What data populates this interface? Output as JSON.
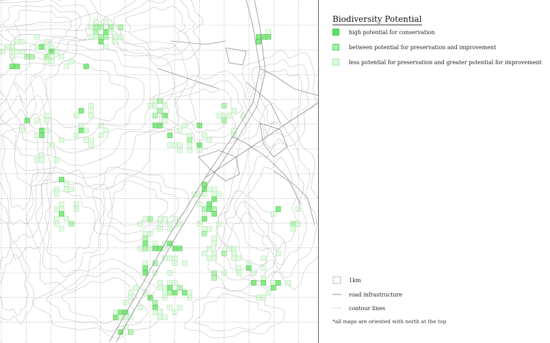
{
  "legend": {
    "title": "Biodiversity Potential",
    "categories": [
      {
        "label": "high potential for conservation",
        "fill": "#5ee35e",
        "stroke": "#3fbf3f"
      },
      {
        "label": "between potential for preservation and improvement",
        "fill": "#a3f0a3",
        "stroke": "#5fd15f"
      },
      {
        "label": "less potential for preservation and greater potential for improvement",
        "fill": "#dcf8dc",
        "stroke": "#9fe59f"
      }
    ],
    "reference": [
      {
        "label": "1km",
        "icon": "grid-cell-icon"
      },
      {
        "label": "road infrastructure",
        "icon": "road-line-icon"
      },
      {
        "label": "contour lines",
        "icon": "contour-line-icon"
      }
    ],
    "note": "*all maps are oriented with north at the top"
  },
  "colors": {
    "grid": "#9a9a9a",
    "road": "#8c8c8c",
    "contour": "#c8c8c8",
    "high": "#5ee35e",
    "mid": "#a3f0a3",
    "low": "#dcf8dc"
  }
}
